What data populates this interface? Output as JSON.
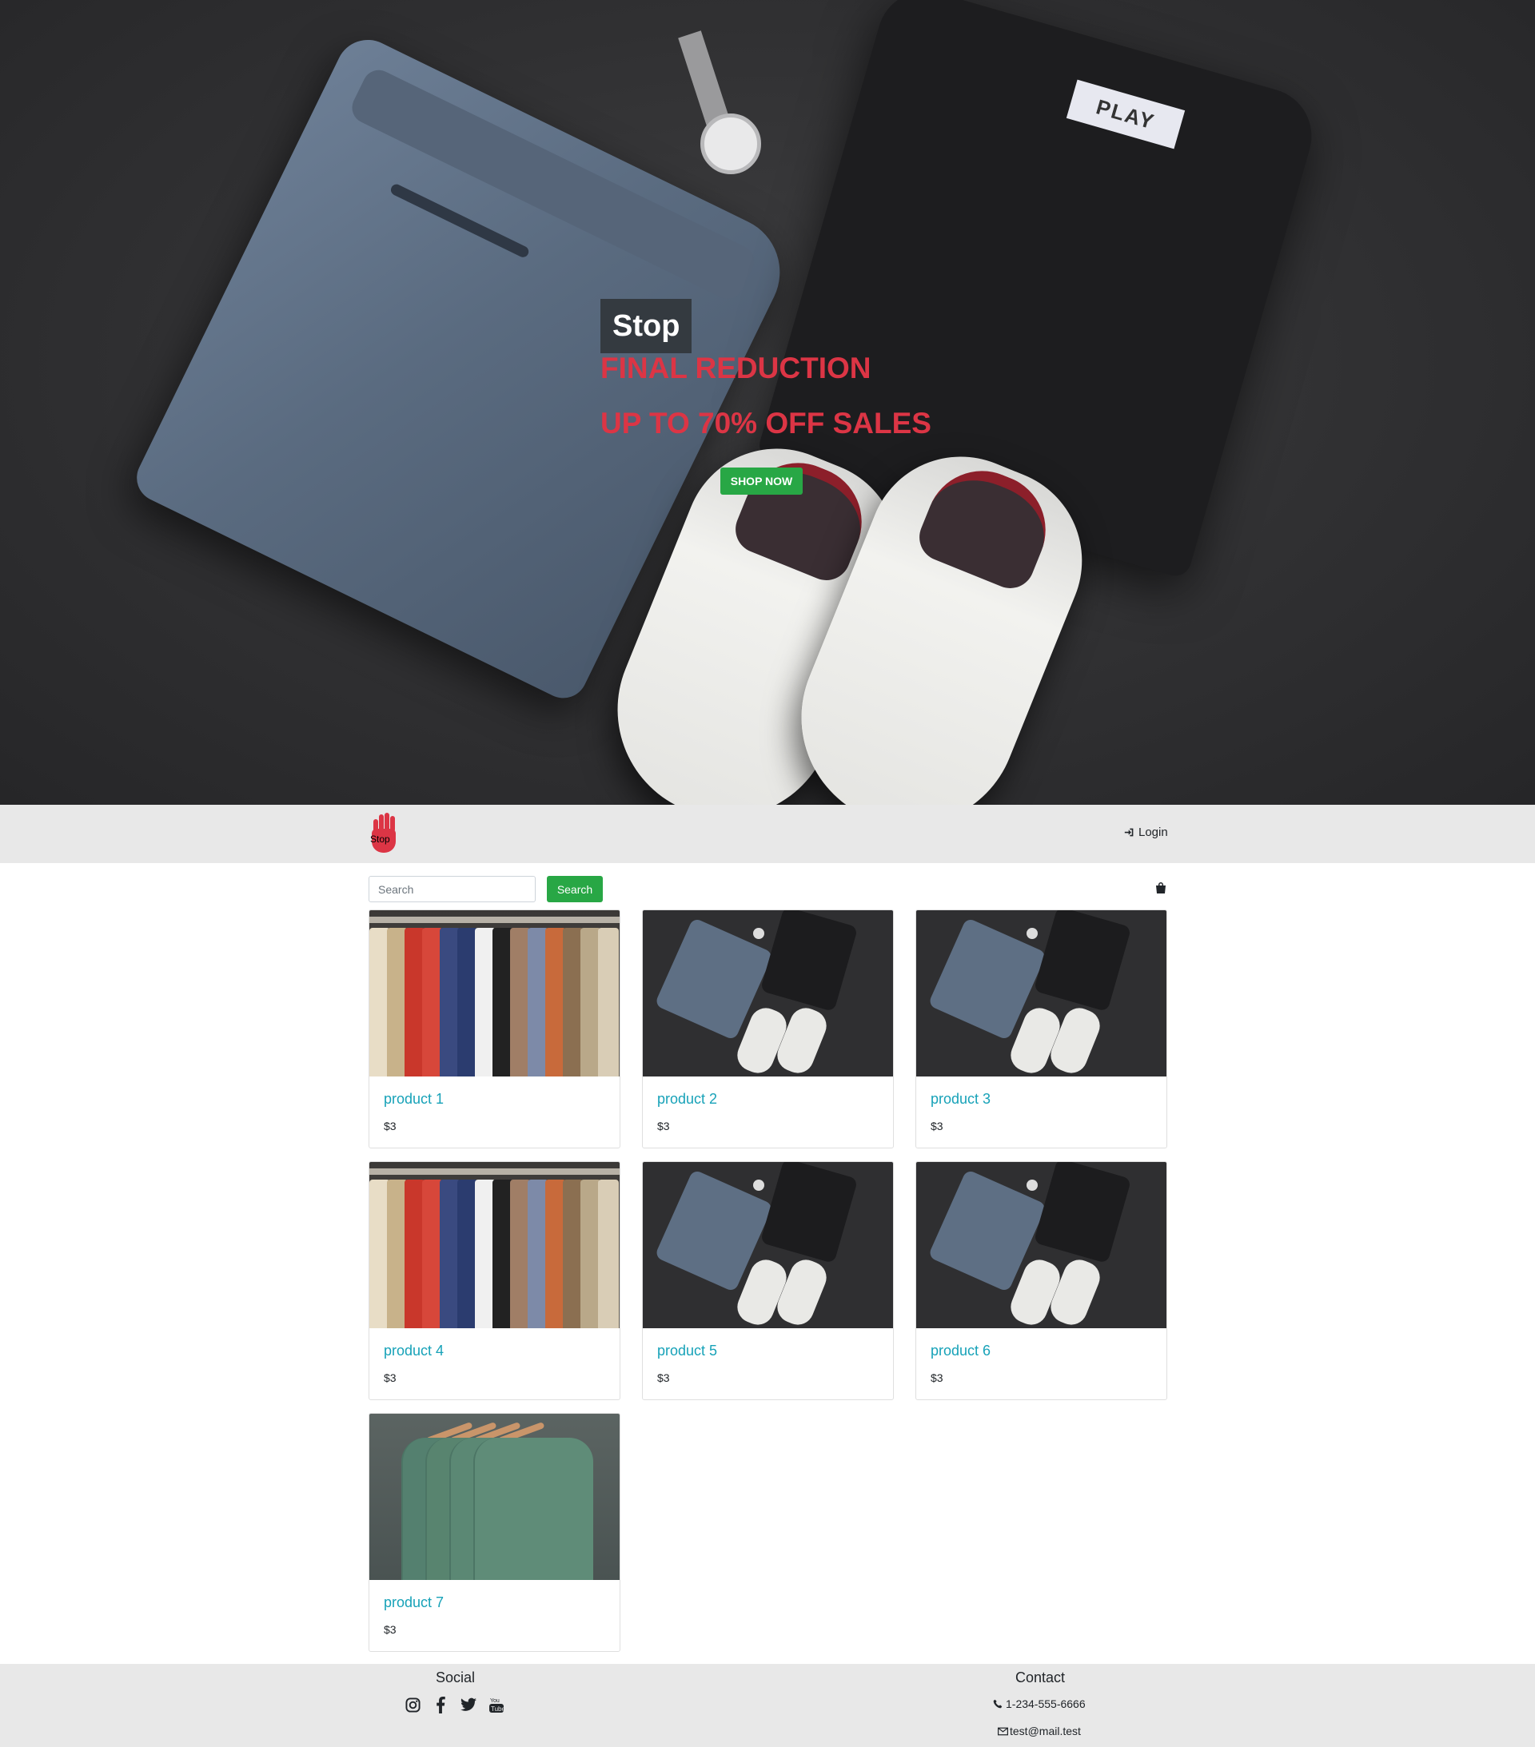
{
  "hero": {
    "brand": "Stop",
    "line1": "FINAL REDUCTION",
    "line2": "UP TO 70% OFF SALES",
    "cta_label": "SHOP NOW",
    "shirt_tag": "PLAY"
  },
  "navbar": {
    "logo_text": "Stop",
    "login_label": "Login"
  },
  "search": {
    "placeholder": "Search",
    "button_label": "Search"
  },
  "products": [
    {
      "name": "product 1",
      "price": "$3",
      "image": "clothing-rack"
    },
    {
      "name": "product 2",
      "price": "$3",
      "image": "flat-lay-outfit"
    },
    {
      "name": "product 3",
      "price": "$3",
      "image": "flat-lay-outfit"
    },
    {
      "name": "product 4",
      "price": "$3",
      "image": "clothing-rack"
    },
    {
      "name": "product 5",
      "price": "$3",
      "image": "flat-lay-outfit"
    },
    {
      "name": "product 6",
      "price": "$3",
      "image": "flat-lay-outfit"
    },
    {
      "name": "product 7",
      "price": "$3",
      "image": "green-tshirts"
    }
  ],
  "footer": {
    "social_title": "Social",
    "social_icons": [
      "instagram-icon",
      "facebook-icon",
      "twitter-icon",
      "youtube-icon"
    ],
    "contact_title": "Contact",
    "phone": "1-234-555-6666",
    "email": "test@mail.test"
  },
  "colors": {
    "accent_green": "#28a745",
    "sale_red": "#dc3545",
    "product_link": "#17a2b8",
    "bar_gray": "#e8e8e8"
  }
}
